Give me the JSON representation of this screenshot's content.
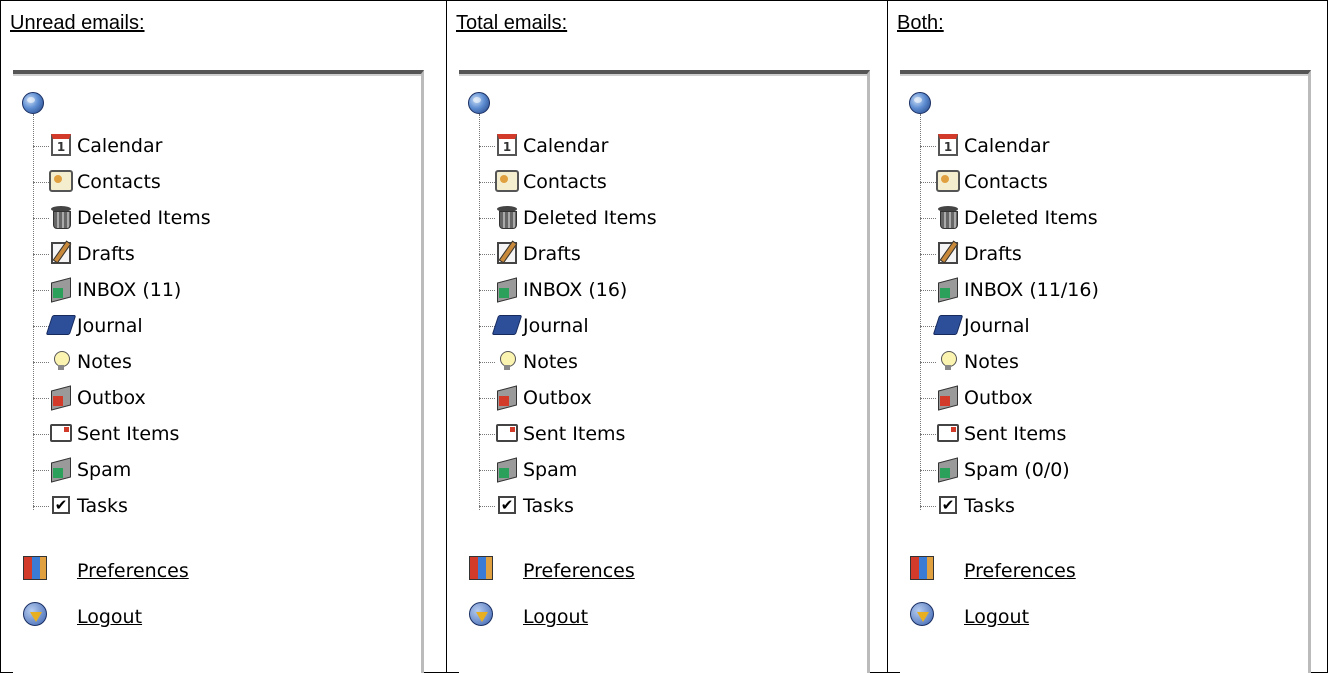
{
  "columns": [
    {
      "header": "Unread emails:",
      "folders": [
        "Calendar",
        "Contacts",
        "Deleted Items",
        "Drafts",
        "INBOX (11)",
        "Journal",
        "Notes",
        "Outbox",
        "Sent Items",
        "Spam",
        "Tasks"
      ],
      "preferences": "Preferences",
      "logout": "Logout"
    },
    {
      "header": "Total emails:",
      "folders": [
        "Calendar",
        "Contacts",
        "Deleted Items",
        "Drafts",
        "INBOX (16)",
        "Journal",
        "Notes",
        "Outbox",
        "Sent Items",
        "Spam",
        "Tasks"
      ],
      "preferences": "Preferences",
      "logout": "Logout"
    },
    {
      "header": "Both:",
      "folders": [
        "Calendar",
        "Contacts",
        "Deleted Items",
        "Drafts",
        "INBOX (11/16)",
        "Journal",
        "Notes",
        "Outbox",
        "Sent Items",
        "Spam (0/0)",
        "Tasks"
      ],
      "preferences": "Preferences",
      "logout": "Logout"
    }
  ],
  "folder_icons": [
    "calendar-icon",
    "contacts-icon",
    "trash-icon",
    "drafts-icon",
    "inbox-icon",
    "journal-icon",
    "notes-icon",
    "outbox-icon",
    "sent-icon",
    "spam-icon",
    "tasks-icon"
  ]
}
